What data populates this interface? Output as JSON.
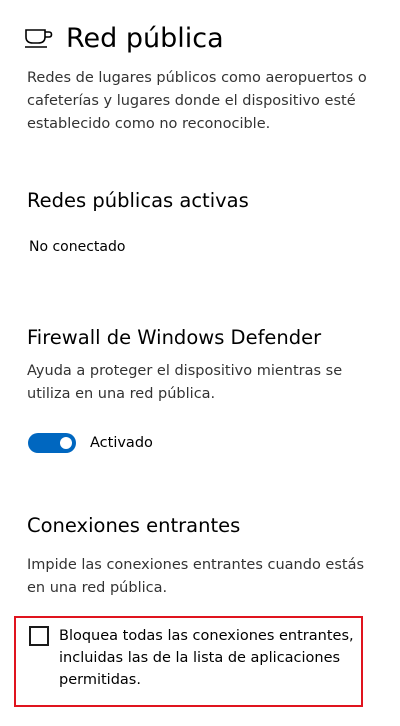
{
  "header": {
    "title": "Red pública",
    "icon": "coffee-cup-icon"
  },
  "intro": {
    "description": "Redes de lugares públicos como aeropuertos o cafeterías y lugares donde el dispositivo esté establecido como no reconocible."
  },
  "active_networks": {
    "heading": "Redes públicas activas",
    "status": "No conectado"
  },
  "firewall": {
    "heading": "Firewall de Windows Defender",
    "description": "Ayuda a proteger el dispositivo mientras se utiliza en una red pública.",
    "toggle_label": "Activado",
    "toggle_on": true
  },
  "incoming": {
    "heading": "Conexiones entrantes",
    "description": "Impide las conexiones entrantes cuando estás en una red pública.",
    "checkbox_label": "Bloquea todas las conexiones entrantes, incluidas las de la lista de aplicaciones permitidas.",
    "checkbox_checked": false
  },
  "colors": {
    "accent": "#0067c0",
    "highlight": "#e0141e",
    "text": "#000000",
    "secondary_text": "#333333"
  }
}
